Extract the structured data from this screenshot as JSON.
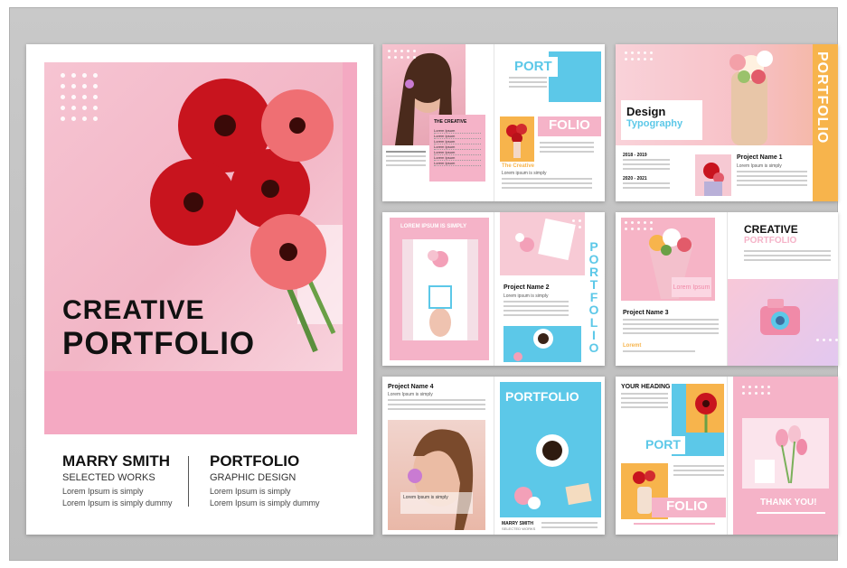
{
  "cover": {
    "title_line1": "CREATIVE",
    "title_line2": "PORTFOLIO",
    "left_name": "MARRY SMITH",
    "left_sub": "SELECTED WORKS",
    "left_line1": "Lorem Ipsum is simply",
    "left_line2": "Lorem Ipsum is simply dummy",
    "right_name": "PORTFOLIO",
    "right_sub": "GRAPHIC DESIGN",
    "right_line1": "Lorem Ipsum is simply",
    "right_line2": "Lorem Ipsum is simply dummy"
  },
  "spread1": {
    "port": "PORT",
    "folio": "FOLIO",
    "toc_title": "THE CREATIVE",
    "toc_items": [
      "Lorem Ipsum",
      "Lorem Ipsum",
      "Lorem Ipsum",
      "Lorem Ipsum",
      "Lorem Ipsum",
      "Lorem Ipsum",
      "Lorem Ipsum"
    ],
    "creative_label": "The Creative",
    "creative_sub": "Lorem ipsum is simply"
  },
  "spread2": {
    "design": "Design",
    "typography": "Typography",
    "vertical": "PORTFOLIO",
    "years1": "2018 - 2019",
    "years2": "2020 - 2021",
    "project": "Project Name 1",
    "project_sub": "Lorem Ipsum is simply"
  },
  "spread3": {
    "header": "LOREM IPSUM IS SIMPLY",
    "project": "Project Name 2",
    "project_sub": "Lorem ipsum is simply",
    "vertical": "PORTFOLIO"
  },
  "spread4": {
    "creative": "CREATIVE",
    "portfolio": "PORTFOLIO",
    "project": "Project Name 3",
    "lorem_box": "Lorem Ipsum",
    "lorem_label": "Loremt"
  },
  "spread5": {
    "project": "Project Name 4",
    "project_sub": "Lorem Ipsum is simply",
    "portfolio": "PORTFOLIO",
    "caption": "Lorem Ipsum is simply",
    "footer_name": "MARRY SMITH",
    "footer_sub": "SELECTED WORKS"
  },
  "spread6": {
    "heading": "YOUR HEADING",
    "port": "PORT",
    "folio": "FOLIO",
    "thanks": "THANK YOU!"
  },
  "colors": {
    "pink": "#f5b3c8",
    "light_pink": "#fbd6e2",
    "sky_blue": "#5cc8e8",
    "orange": "#f7b44c",
    "ink": "#111111"
  }
}
